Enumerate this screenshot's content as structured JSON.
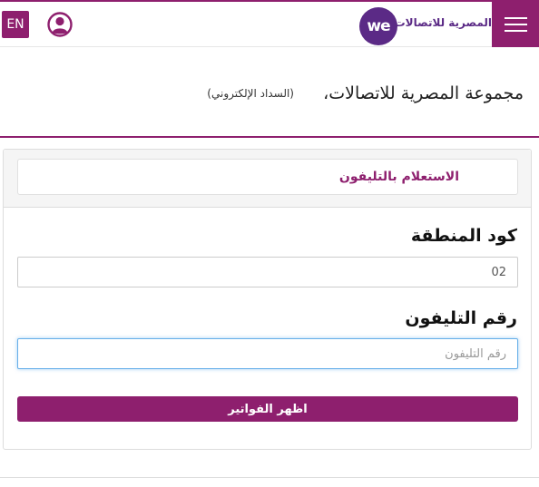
{
  "header": {
    "lang_label": "EN",
    "brand_text": "المصرية للاتصالات",
    "logo_text": "we",
    "icons": {
      "user": "user-circle-icon",
      "menu": "hamburger-menu-icon"
    },
    "colors": {
      "brand": "#8e1f6e",
      "logo": "#5b2a86"
    }
  },
  "page": {
    "title": "مجموعة المصرية للاتصالات،",
    "subtitle": "(السداد الإلكتروني)"
  },
  "form": {
    "tab_label": "الاستعلام بالتليفون",
    "area_code_label": "كود المنطقة",
    "area_code_value": "02",
    "phone_label": "رقم التليفون",
    "phone_placeholder": "رقم التليفون",
    "submit_label": "اظهر الفواتير"
  }
}
